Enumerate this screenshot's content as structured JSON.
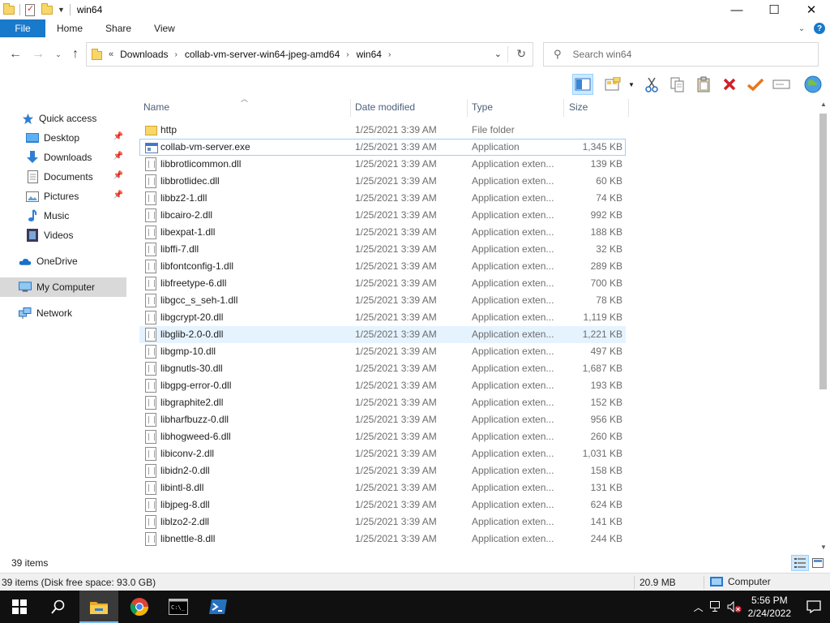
{
  "window": {
    "title": "win64",
    "controls": {
      "minimize": "—",
      "maximize": "☐",
      "close": "✕"
    }
  },
  "ribbon": {
    "file": "File",
    "tabs": [
      "Home",
      "Share",
      "View"
    ],
    "expand_icon": "chevron-down-icon",
    "help": "?"
  },
  "address": {
    "overflow": "«",
    "crumbs": [
      "Downloads",
      "collab-vm-server-win64-jpeg-amd64",
      "win64"
    ],
    "sep": "›"
  },
  "search": {
    "placeholder": "Search win64"
  },
  "nav": {
    "items": [
      {
        "label": "Quick access",
        "icon": "star-icon"
      },
      {
        "label": "Desktop",
        "icon": "desktop-icon",
        "pinned": true
      },
      {
        "label": "Downloads",
        "icon": "download-icon",
        "pinned": true
      },
      {
        "label": "Documents",
        "icon": "documents-icon",
        "pinned": true
      },
      {
        "label": "Pictures",
        "icon": "pictures-icon",
        "pinned": true
      },
      {
        "label": "Music",
        "icon": "music-icon"
      },
      {
        "label": "Videos",
        "icon": "videos-icon"
      },
      {
        "label": "OneDrive",
        "icon": "onedrive-icon"
      },
      {
        "label": "My Computer",
        "icon": "computer-icon",
        "selected": true
      },
      {
        "label": "Network",
        "icon": "network-icon"
      }
    ]
  },
  "columns": {
    "name": "Name",
    "date": "Date modified",
    "type": "Type",
    "size": "Size"
  },
  "files": [
    {
      "name": "http",
      "date": "1/25/2021 3:39 AM",
      "type": "File folder",
      "size": "",
      "kind": "folder"
    },
    {
      "name": "collab-vm-server.exe",
      "date": "1/25/2021 3:39 AM",
      "type": "Application",
      "size": "1,345 KB",
      "kind": "exe",
      "focused": true
    },
    {
      "name": "libbrotlicommon.dll",
      "date": "1/25/2021 3:39 AM",
      "type": "Application exten...",
      "size": "139 KB",
      "kind": "dll"
    },
    {
      "name": "libbrotlidec.dll",
      "date": "1/25/2021 3:39 AM",
      "type": "Application exten...",
      "size": "60 KB",
      "kind": "dll"
    },
    {
      "name": "libbz2-1.dll",
      "date": "1/25/2021 3:39 AM",
      "type": "Application exten...",
      "size": "74 KB",
      "kind": "dll"
    },
    {
      "name": "libcairo-2.dll",
      "date": "1/25/2021 3:39 AM",
      "type": "Application exten...",
      "size": "992 KB",
      "kind": "dll"
    },
    {
      "name": "libexpat-1.dll",
      "date": "1/25/2021 3:39 AM",
      "type": "Application exten...",
      "size": "188 KB",
      "kind": "dll"
    },
    {
      "name": "libffi-7.dll",
      "date": "1/25/2021 3:39 AM",
      "type": "Application exten...",
      "size": "32 KB",
      "kind": "dll"
    },
    {
      "name": "libfontconfig-1.dll",
      "date": "1/25/2021 3:39 AM",
      "type": "Application exten...",
      "size": "289 KB",
      "kind": "dll"
    },
    {
      "name": "libfreetype-6.dll",
      "date": "1/25/2021 3:39 AM",
      "type": "Application exten...",
      "size": "700 KB",
      "kind": "dll"
    },
    {
      "name": "libgcc_s_seh-1.dll",
      "date": "1/25/2021 3:39 AM",
      "type": "Application exten...",
      "size": "78 KB",
      "kind": "dll"
    },
    {
      "name": "libgcrypt-20.dll",
      "date": "1/25/2021 3:39 AM",
      "type": "Application exten...",
      "size": "1,119 KB",
      "kind": "dll"
    },
    {
      "name": "libglib-2.0-0.dll",
      "date": "1/25/2021 3:39 AM",
      "type": "Application exten...",
      "size": "1,221 KB",
      "kind": "dll",
      "hover": true
    },
    {
      "name": "libgmp-10.dll",
      "date": "1/25/2021 3:39 AM",
      "type": "Application exten...",
      "size": "497 KB",
      "kind": "dll"
    },
    {
      "name": "libgnutls-30.dll",
      "date": "1/25/2021 3:39 AM",
      "type": "Application exten...",
      "size": "1,687 KB",
      "kind": "dll"
    },
    {
      "name": "libgpg-error-0.dll",
      "date": "1/25/2021 3:39 AM",
      "type": "Application exten...",
      "size": "193 KB",
      "kind": "dll"
    },
    {
      "name": "libgraphite2.dll",
      "date": "1/25/2021 3:39 AM",
      "type": "Application exten...",
      "size": "152 KB",
      "kind": "dll"
    },
    {
      "name": "libharfbuzz-0.dll",
      "date": "1/25/2021 3:39 AM",
      "type": "Application exten...",
      "size": "956 KB",
      "kind": "dll"
    },
    {
      "name": "libhogweed-6.dll",
      "date": "1/25/2021 3:39 AM",
      "type": "Application exten...",
      "size": "260 KB",
      "kind": "dll"
    },
    {
      "name": "libiconv-2.dll",
      "date": "1/25/2021 3:39 AM",
      "type": "Application exten...",
      "size": "1,031 KB",
      "kind": "dll"
    },
    {
      "name": "libidn2-0.dll",
      "date": "1/25/2021 3:39 AM",
      "type": "Application exten...",
      "size": "158 KB",
      "kind": "dll"
    },
    {
      "name": "libintl-8.dll",
      "date": "1/25/2021 3:39 AM",
      "type": "Application exten...",
      "size": "131 KB",
      "kind": "dll"
    },
    {
      "name": "libjpeg-8.dll",
      "date": "1/25/2021 3:39 AM",
      "type": "Application exten...",
      "size": "624 KB",
      "kind": "dll"
    },
    {
      "name": "liblzo2-2.dll",
      "date": "1/25/2021 3:39 AM",
      "type": "Application exten...",
      "size": "141 KB",
      "kind": "dll"
    },
    {
      "name": "libnettle-8.dll",
      "date": "1/25/2021 3:39 AM",
      "type": "Application exten...",
      "size": "244 KB",
      "kind": "dll"
    }
  ],
  "status": {
    "item_count": "39 items",
    "disk": "39 items (Disk free space: 93.0 GB)",
    "size": "20.9 MB",
    "location": "Computer"
  },
  "taskbar": {
    "time": "5:56 PM",
    "date": "2/24/2022",
    "apps": [
      "start-icon",
      "search-icon",
      "file-explorer-icon",
      "chrome-icon",
      "command-prompt-icon",
      "powershell-icon"
    ]
  },
  "colors": {
    "accent": "#1979ca",
    "selection": "#cce8ff",
    "hover": "#e5f3ff",
    "header_text": "#4c607a"
  }
}
